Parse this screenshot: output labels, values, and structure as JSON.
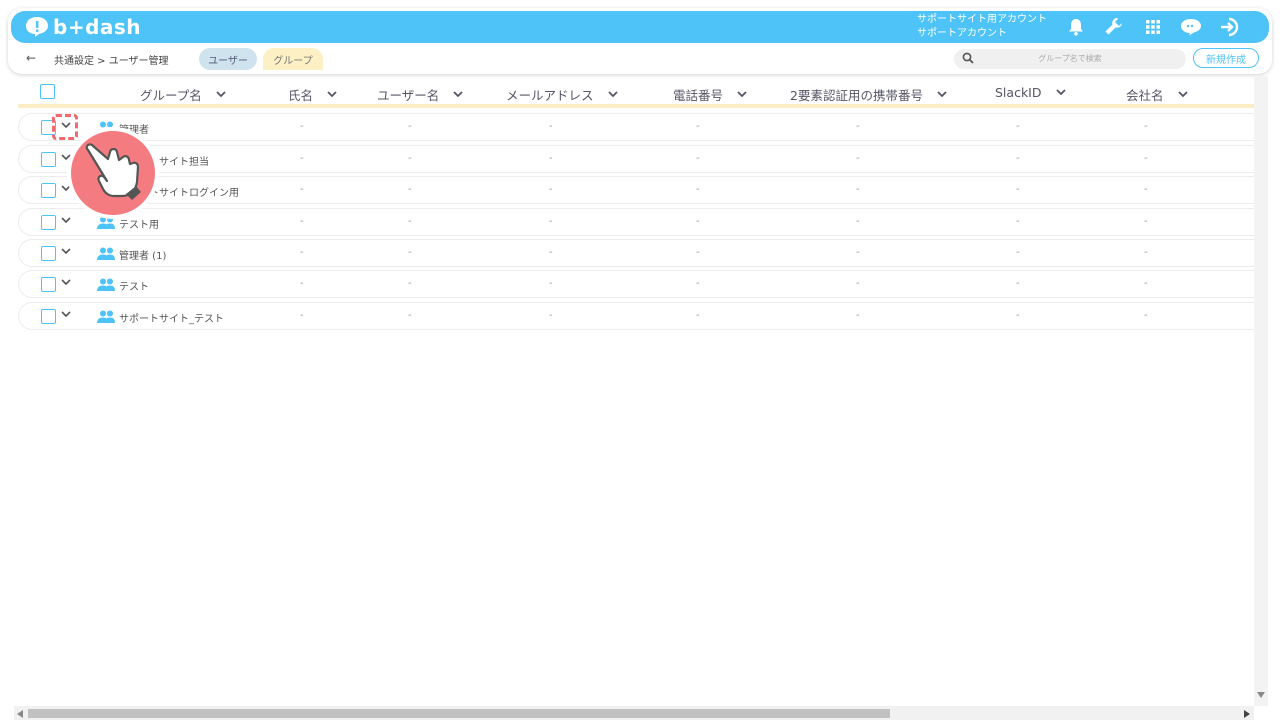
{
  "app": {
    "logo_text": "b+dash",
    "account_line1": "サポートサイト用アカウント",
    "account_line2": "サポートアカウント",
    "icons": [
      "bell-icon",
      "wrench-icon",
      "grid-icon",
      "chat-icon",
      "logout-icon"
    ],
    "brand_color": "#4ec3f7"
  },
  "breadcrumb": {
    "back_label": "←",
    "path": "共通設定 > ユーザー管理"
  },
  "tabs": [
    {
      "label": "ユーザー",
      "active": false
    },
    {
      "label": "グループ",
      "active": true
    }
  ],
  "search": {
    "placeholder": "グループ名で検索"
  },
  "new_button_label": "新規作成",
  "columns": [
    "グループ名",
    "氏名",
    "ユーザー名",
    "メールアドレス",
    "電話番号",
    "2要素認証用の携帯番号",
    "SlackID",
    "会社名"
  ],
  "rows": [
    {
      "name": "管理者"
    },
    {
      "name": "サポートサイト担当"
    },
    {
      "name": "サポートサイトログイン用"
    },
    {
      "name": "テスト用"
    },
    {
      "name": "管理者 (1)"
    },
    {
      "name": "テスト"
    },
    {
      "name": "サポートサイト_テスト"
    }
  ],
  "empty_value": "-"
}
